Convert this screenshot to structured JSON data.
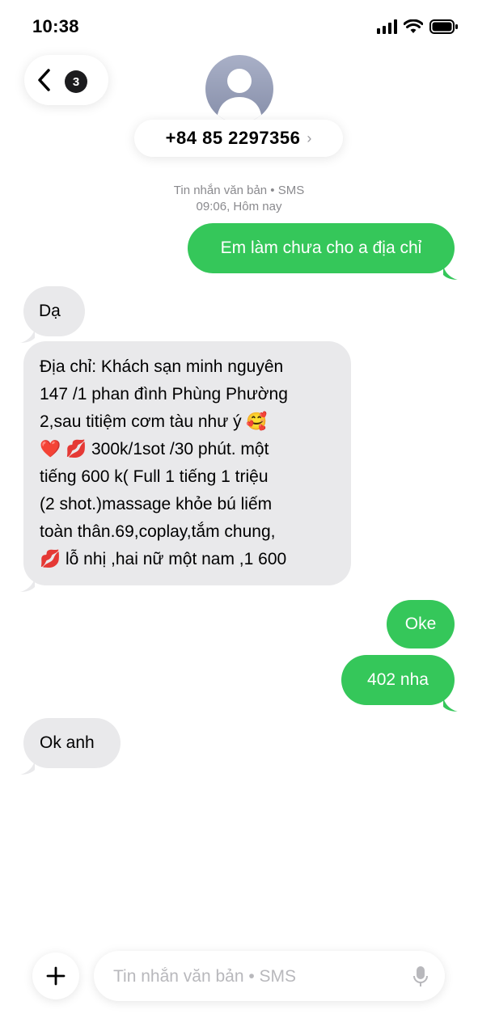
{
  "status_bar": {
    "time": "10:38"
  },
  "header": {
    "unread_count": "3",
    "contact": "+84 85 2297356",
    "chevron": "›"
  },
  "thread_meta": {
    "service": "Tin nhắn văn bản • SMS",
    "timestamp": "09:06, Hôm nay"
  },
  "messages": [
    {
      "direction": "outgoing",
      "text": "Em làm chưa cho a địa chỉ"
    },
    {
      "direction": "incoming",
      "text": "Dạ"
    },
    {
      "direction": "incoming",
      "lines": [
        "Địa chỉ: Khách sạn minh nguyên",
        "147 /1 phan đình Phùng Phường",
        "2,sau titiệm cơm tàu như ý 🥰",
        "❤️ 💋 300k/1sot /30 phút. một",
        "tiếng  600 k( Full 1 tiếng 1 triệu",
        "(2 shot.)massage khỏe bú liếm",
        "toàn thân.69,coplay,tắm chung,",
        "💋 lỗ nhị ,hai nữ một nam ,1 600"
      ]
    },
    {
      "direction": "outgoing",
      "text": "Oke"
    },
    {
      "direction": "outgoing",
      "text": "402 nha"
    },
    {
      "direction": "incoming",
      "text": "Ok anh"
    }
  ],
  "composer": {
    "placeholder": "Tin nhắn văn bản • SMS",
    "add_label": "+"
  },
  "icons": [
    "back-chevron-icon",
    "person-icon",
    "cellular-signal-icon",
    "wifi-icon",
    "battery-icon",
    "plus-icon",
    "microphone-icon"
  ],
  "colors": {
    "outgoing_bubble": "#35c75a",
    "incoming_bubble": "#e9e9eb",
    "meta_text": "#8a8a8e"
  }
}
